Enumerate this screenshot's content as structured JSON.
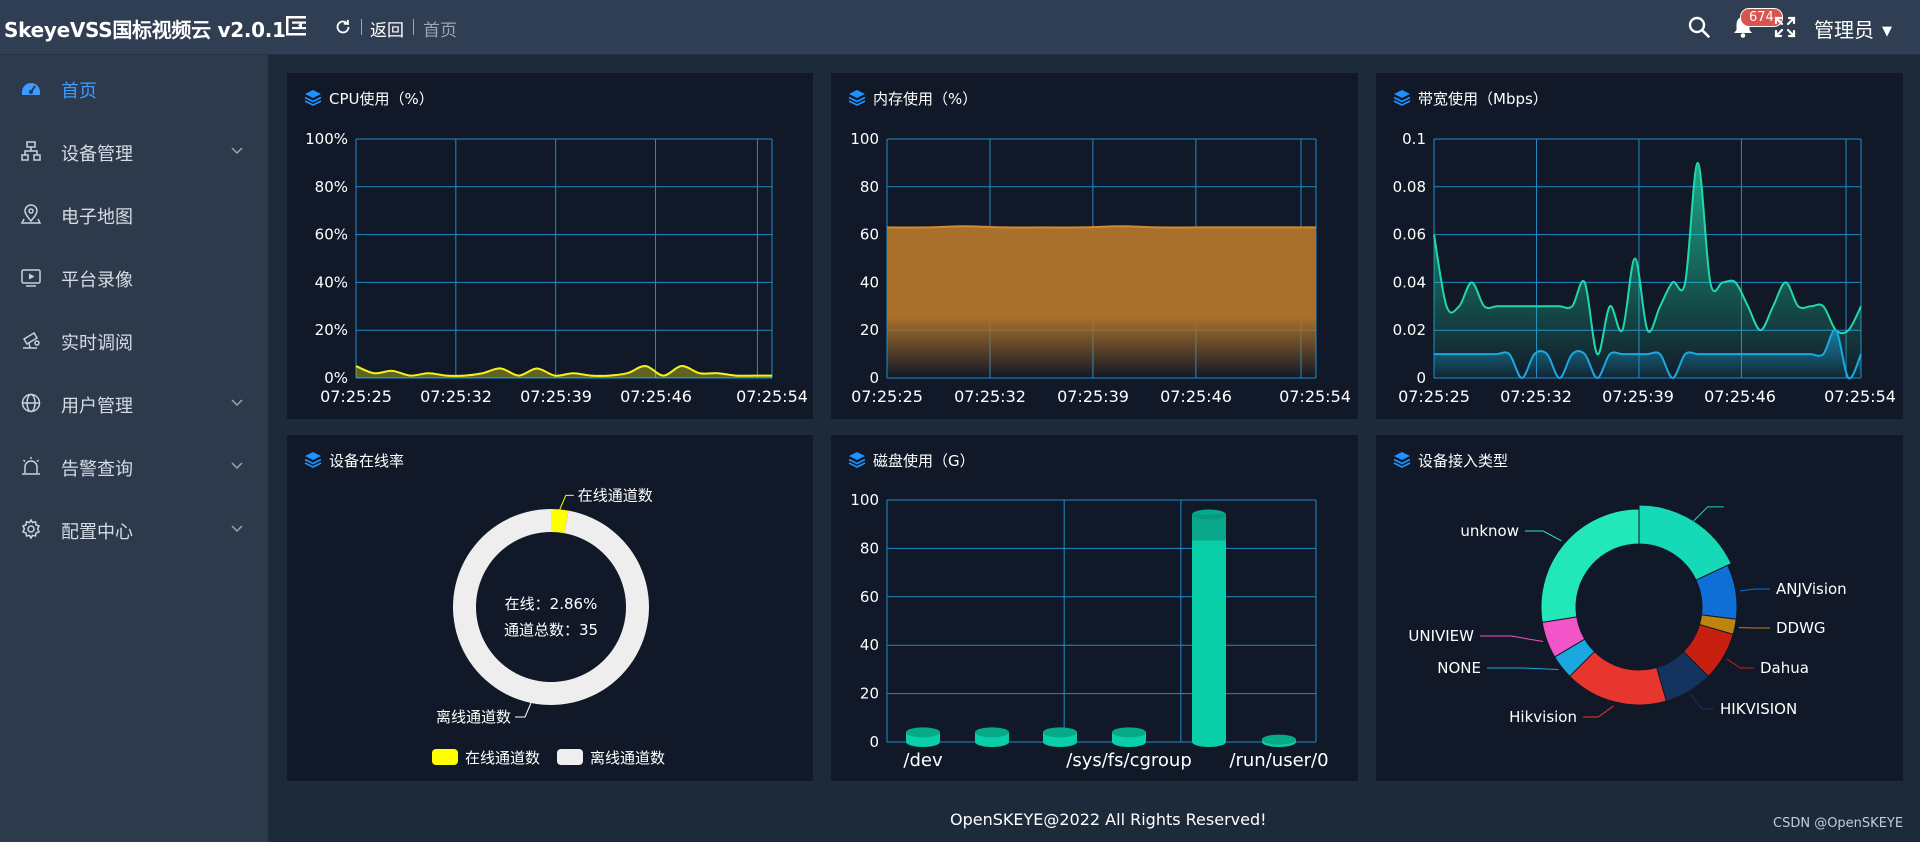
{
  "app": {
    "title": "SkeyeVSS国标视频云 v2.0.1"
  },
  "header": {
    "back_label": "返回",
    "breadcrumb": "首页",
    "notification_count": "674",
    "user_label": "管理员"
  },
  "sidebar": {
    "items": [
      {
        "label": "首页",
        "icon": "dashboard-icon",
        "expandable": false,
        "active": true
      },
      {
        "label": "设备管理",
        "icon": "device-tree-icon",
        "expandable": true
      },
      {
        "label": "电子地图",
        "icon": "map-pin-icon",
        "expandable": false
      },
      {
        "label": "平台录像",
        "icon": "video-icon",
        "expandable": false
      },
      {
        "label": "实时调阅",
        "icon": "live-view-icon",
        "expandable": false
      },
      {
        "label": "用户管理",
        "icon": "globe-icon",
        "expandable": true
      },
      {
        "label": "告警查询",
        "icon": "alarm-icon",
        "expandable": true
      },
      {
        "label": "配置中心",
        "icon": "gear-icon",
        "expandable": true
      }
    ]
  },
  "colors": {
    "accent": "#3c9bff",
    "panel_bg": "#111827",
    "grid": "#1f8cc7",
    "cpu_line": "#f3f31a",
    "mem_fill": "#b8782b",
    "bw_series1": "#20d9ab",
    "bw_series2": "#1aa8e0",
    "online": "#ffff00",
    "offline": "#eeeeee",
    "disk_bar": "#08cfa8"
  },
  "panels": {
    "cpu": {
      "title": "CPU使用（%）"
    },
    "memory": {
      "title": "内存使用（%）"
    },
    "bandwidth": {
      "title": "带宽使用（Mbps）"
    },
    "online": {
      "title": "设备在线率",
      "center_line1": "在线：2.86%",
      "center_line2": "通道总数：35"
    },
    "disk": {
      "title": "磁盘使用（G）"
    },
    "access": {
      "title": "设备接入类型"
    }
  },
  "chart_data": [
    {
      "id": "cpu",
      "type": "line",
      "x": [
        "07:25:25",
        "07:25:32",
        "07:25:39",
        "07:25:46",
        "07:25:54"
      ],
      "y_ticks": [
        "0%",
        "20%",
        "40%",
        "60%",
        "80%",
        "100%"
      ],
      "ylim": [
        0,
        100
      ],
      "series": [
        {
          "values": [
            5,
            2,
            3,
            1,
            2,
            1,
            1,
            2,
            4,
            1,
            4,
            1,
            2,
            1,
            1,
            2,
            5,
            1,
            5,
            2,
            2,
            1,
            1,
            1
          ]
        }
      ]
    },
    {
      "id": "memory",
      "type": "area",
      "x": [
        "07:25:25",
        "07:25:32",
        "07:25:39",
        "07:25:46",
        "07:25:54"
      ],
      "y_ticks": [
        "0",
        "20",
        "40",
        "60",
        "80",
        "100"
      ],
      "ylim": [
        0,
        100
      ],
      "series": [
        {
          "values": [
            63,
            63,
            63.5,
            63,
            63,
            63,
            63.5,
            63,
            63,
            63,
            63,
            63
          ]
        }
      ]
    },
    {
      "id": "bandwidth",
      "type": "area",
      "x": [
        "07:25:25",
        "07:25:32",
        "07:25:39",
        "07:25:46",
        "07:25:54"
      ],
      "y_ticks": [
        "0",
        "0.02",
        "0.04",
        "0.06",
        "0.08",
        "0.1"
      ],
      "ylim": [
        0,
        0.1
      ],
      "series": [
        {
          "values": [
            0.06,
            0.03,
            0.03,
            0.04,
            0.03,
            0.03,
            0.03,
            0.03,
            0.03,
            0.03,
            0.03,
            0.03,
            0.04,
            0.01,
            0.03,
            0.02,
            0.05,
            0.02,
            0.03,
            0.04,
            0.04,
            0.09,
            0.04,
            0.04,
            0.04,
            0.03,
            0.02,
            0.03,
            0.04,
            0.03,
            0.03,
            0.03,
            0.02,
            0.02,
            0.03
          ]
        },
        {
          "values": [
            0.01,
            0.01,
            0.01,
            0.01,
            0.01,
            0.01,
            0.01,
            0.0,
            0.01,
            0.01,
            0.0,
            0.01,
            0.01,
            0.0,
            0.01,
            0.01,
            0.01,
            0.01,
            0.01,
            0.0,
            0.01,
            0.01,
            0.01,
            0.01,
            0.01,
            0.01,
            0.01,
            0.01,
            0.01,
            0.01,
            0.01,
            0.01,
            0.02,
            0.0,
            0.01
          ]
        }
      ]
    },
    {
      "id": "online",
      "type": "pie",
      "labels": [
        "在线通道数",
        "离线通道数"
      ],
      "values": [
        2.86,
        97.14
      ],
      "legend": [
        "在线通道数",
        "离线通道数"
      ]
    },
    {
      "id": "disk",
      "type": "bar",
      "categories": [
        "/dev",
        "",
        "",
        "/sys/fs/cgroup",
        "",
        "/run/user/0"
      ],
      "values": [
        4,
        4,
        4,
        4,
        94,
        1
      ],
      "y_ticks": [
        "0",
        "20",
        "40",
        "60",
        "80",
        "100"
      ],
      "ylim": [
        0,
        100
      ]
    },
    {
      "id": "access",
      "type": "pie",
      "labels": [
        "",
        "ANJVision",
        "DDWG",
        "Dahua",
        "HIKVISION",
        "Hikvision",
        "NONE",
        "UNIVIEW",
        "unknow"
      ],
      "values": [
        18,
        9,
        2.5,
        8,
        8,
        17,
        4,
        6,
        27.5
      ],
      "colors": [
        "#16d9b8",
        "#0f6fd6",
        "#bd8410",
        "#c72010",
        "#14335f",
        "#e8362f",
        "#1aa8e0",
        "#f155c8",
        "#22e8b9"
      ]
    }
  ],
  "footer": {
    "text": "OpenSKEYE@2022 All Rights Reserved!",
    "watermark": "CSDN @OpenSKEYE"
  }
}
